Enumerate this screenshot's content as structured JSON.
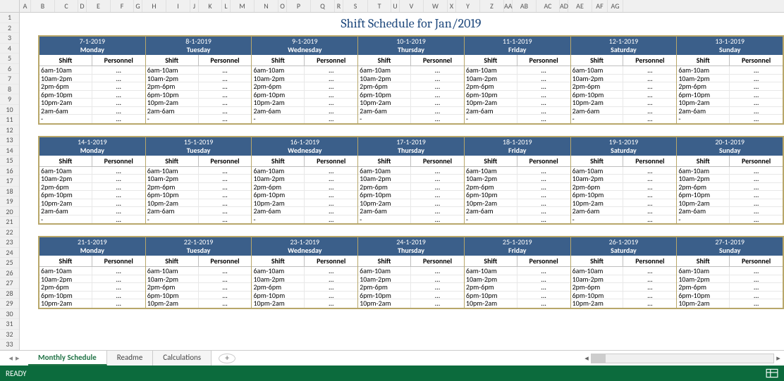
{
  "title": "Shift Schedule for Jan/2019",
  "columns": [
    "A",
    "B",
    "C",
    "D",
    "E",
    "F",
    "G",
    "H",
    "I",
    "J",
    "K",
    "L",
    "M",
    "N",
    "O",
    "P",
    "Q",
    "R",
    "S",
    "T",
    "U",
    "V",
    "W",
    "X",
    "Y",
    "Z",
    "AA",
    "AB",
    "AC",
    "AD",
    "AE",
    "AF",
    "AG"
  ],
  "rows": [
    "1",
    "2",
    "3",
    "4",
    "5",
    "6",
    "7",
    "8",
    "9",
    "10",
    "11",
    "12",
    "13",
    "14",
    "15",
    "16",
    "17",
    "18",
    "19",
    "20",
    "21",
    "22",
    "23",
    "24",
    "25",
    "26",
    "27",
    "28",
    "29",
    "30",
    "31",
    "32",
    "33"
  ],
  "shift_label": "Shift",
  "personnel_label": "Personnel",
  "placeholder": "...",
  "shift_slots": [
    "6am-10am",
    "10am-2pm",
    "2pm-6pm",
    "6pm-10pm",
    "10pm-2am",
    "2am-6am",
    "-"
  ],
  "shift_slots_short": [
    "6am-10am",
    "10am-2pm",
    "2pm-6pm",
    "6pm-10pm",
    "10pm-2am"
  ],
  "weeks": [
    {
      "days": [
        {
          "date": "7-1-2019",
          "dow": "Monday"
        },
        {
          "date": "8-1-2019",
          "dow": "Tuesday"
        },
        {
          "date": "9-1-2019",
          "dow": "Wednesday"
        },
        {
          "date": "10-1-2019",
          "dow": "Thursday"
        },
        {
          "date": "11-1-2019",
          "dow": "Friday"
        },
        {
          "date": "12-1-2019",
          "dow": "Saturday"
        },
        {
          "date": "13-1-2019",
          "dow": "Sunday"
        }
      ]
    },
    {
      "days": [
        {
          "date": "14-1-2019",
          "dow": "Monday"
        },
        {
          "date": "15-1-2019",
          "dow": "Tuesday"
        },
        {
          "date": "16-1-2019",
          "dow": "Wednesday"
        },
        {
          "date": "17-1-2019",
          "dow": "Thursday"
        },
        {
          "date": "18-1-2019",
          "dow": "Friday"
        },
        {
          "date": "19-1-2019",
          "dow": "Saturday"
        },
        {
          "date": "20-1-2019",
          "dow": "Sunday"
        }
      ]
    },
    {
      "days": [
        {
          "date": "21-1-2019",
          "dow": "Monday"
        },
        {
          "date": "22-1-2019",
          "dow": "Tuesday"
        },
        {
          "date": "23-1-2019",
          "dow": "Wednesday"
        },
        {
          "date": "24-1-2019",
          "dow": "Thursday"
        },
        {
          "date": "25-1-2019",
          "dow": "Friday"
        },
        {
          "date": "26-1-2019",
          "dow": "Saturday"
        },
        {
          "date": "27-1-2019",
          "dow": "Sunday"
        }
      ]
    }
  ],
  "tabs": [
    {
      "label": "Monthly Schedule",
      "active": true
    },
    {
      "label": "Readme",
      "active": false
    },
    {
      "label": "Calculations",
      "active": false
    }
  ],
  "status": "READY"
}
